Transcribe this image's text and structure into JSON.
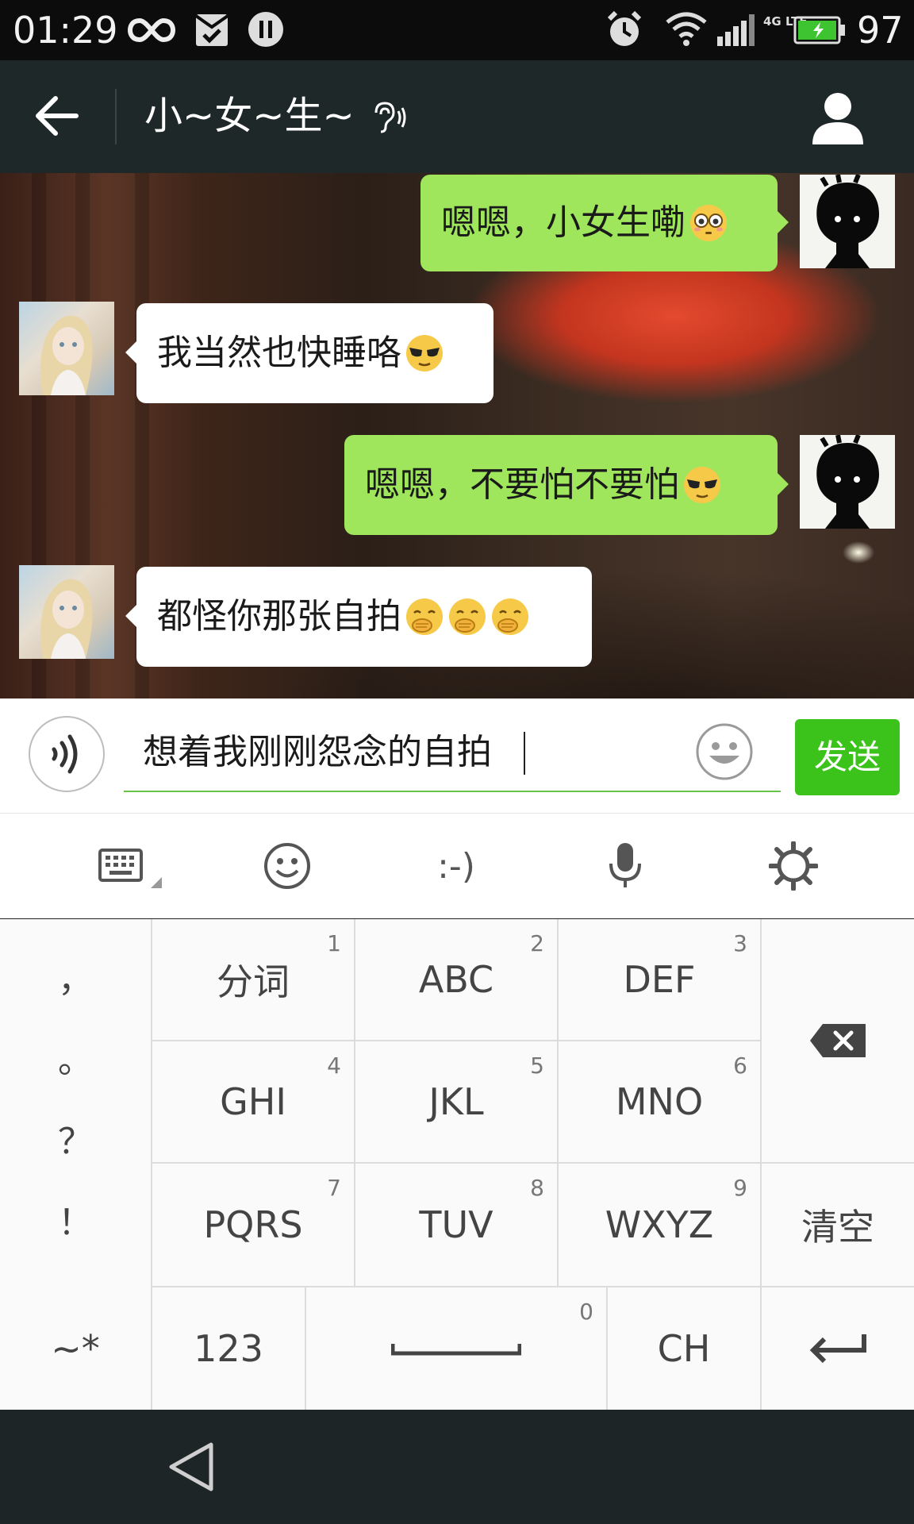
{
  "status_bar": {
    "time": "01:29",
    "battery_percent": "97",
    "network": "4G LTE"
  },
  "header": {
    "title": "小~女~生~"
  },
  "messages": [
    {
      "from": "me",
      "text": "嗯嗯，小女生嘞",
      "emoji": "flushed-face"
    },
    {
      "from": "other",
      "text": "我当然也快睡咯",
      "emoji": "cool-face"
    },
    {
      "from": "me",
      "text": "嗯嗯，不要怕不要怕",
      "emoji": "cool-face"
    },
    {
      "from": "other",
      "text": "都怪你那张自拍",
      "emoji": "shy-face x3"
    }
  ],
  "input": {
    "value": "想着我刚刚怨念的自拍",
    "send_label": "发送"
  },
  "ime_toolbar": {
    "emoticon_label": ":-)"
  },
  "keypad": {
    "punctuation": [
      "，",
      "。",
      "？",
      "！"
    ],
    "keys": [
      {
        "label": "分词",
        "num": "1"
      },
      {
        "label": "ABC",
        "num": "2"
      },
      {
        "label": "DEF",
        "num": "3"
      },
      {
        "label": "GHI",
        "num": "4"
      },
      {
        "label": "JKL",
        "num": "5"
      },
      {
        "label": "MNO",
        "num": "6"
      },
      {
        "label": "PQRS",
        "num": "7"
      },
      {
        "label": "TUV",
        "num": "8"
      },
      {
        "label": "WXYZ",
        "num": "9"
      }
    ],
    "clear_label": "清空",
    "symbols_label": "~*",
    "numbers_label": "123",
    "space_num": "0",
    "lang_label": "CH"
  },
  "colors": {
    "accent_green": "#3cc31b",
    "bubble_me": "#9fe65c",
    "title_bar": "#1e2829"
  }
}
